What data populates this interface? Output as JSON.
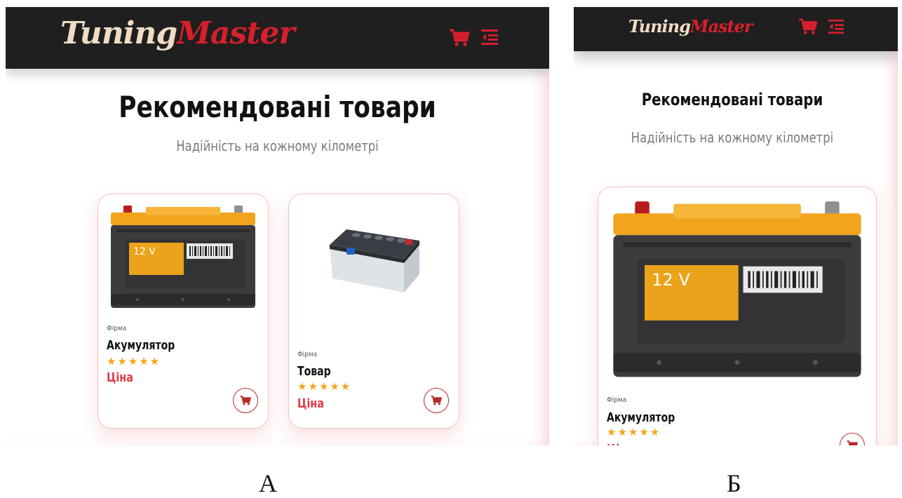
{
  "brand": {
    "logo_part1": "Tuning",
    "logo_part2": "Master"
  },
  "section": {
    "title": "Рекомендовані товари",
    "subtitle": "Надійність на кожному кілометрі"
  },
  "products": [
    {
      "brand": "Фірма",
      "name": "Акумулятор",
      "rating": 5,
      "stars": "★★★★★",
      "price": "Ціна",
      "image": "car-battery-12v-front",
      "label_12v": "12 V"
    },
    {
      "brand": "Фірма",
      "name": "Товар",
      "rating": 5,
      "stars": "★★★★★",
      "price": "Ціна",
      "image": "car-battery-3d"
    }
  ],
  "captions": {
    "left": "А",
    "right": "Б"
  },
  "icons": {
    "header_cart": "cart-icon",
    "header_menu": "menu-icon",
    "card_cart": "cart-icon"
  },
  "colors": {
    "header_bg": "#1f1f1f",
    "accent": "#d61f2c",
    "price": "#e23b45",
    "stars": "#f2a51a",
    "logo_light": "#f0dcc4"
  }
}
